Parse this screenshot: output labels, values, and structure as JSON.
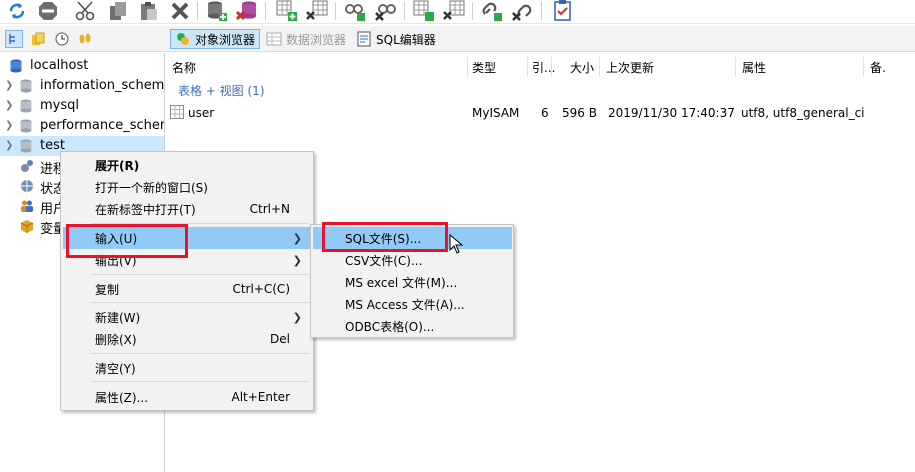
{
  "toolbar2": {
    "tabs": [
      {
        "label": "对象浏览器",
        "state": "active"
      },
      {
        "label": "数据浏览器",
        "state": "disabled"
      },
      {
        "label": "SQL编辑器",
        "state": "normal"
      }
    ]
  },
  "tree": {
    "items": [
      {
        "label": "localhost",
        "icon": "server-icon"
      },
      {
        "label": "information_schema",
        "icon": "database-icon"
      },
      {
        "label": "mysql",
        "icon": "database-icon"
      },
      {
        "label": "performance_schema",
        "icon": "database-icon"
      },
      {
        "label": "test",
        "icon": "database-icon",
        "selected": true
      },
      {
        "label": "进程",
        "icon": "process-icon"
      },
      {
        "label": "状态",
        "icon": "status-icon"
      },
      {
        "label": "用户",
        "icon": "users-icon"
      },
      {
        "label": "变量",
        "icon": "variables-icon"
      }
    ]
  },
  "table": {
    "columns": [
      "名称",
      "类型",
      "引...",
      "大小",
      "上次更新",
      "属性",
      "备."
    ],
    "group_label": "表格 + 视图 (1)",
    "rows": [
      {
        "name": "user",
        "type": "MyISAM",
        "rows": "6",
        "size": "596 B",
        "updated": "2019/11/30 17:40:37",
        "attrs": "utf8, utf8_general_ci"
      }
    ]
  },
  "context_menu": {
    "items": [
      {
        "label": "展开(R)",
        "bold": true
      },
      {
        "label": "打开一个新的窗口(S)"
      },
      {
        "label": "在新标签中打开(T)",
        "shortcut": "Ctrl+N"
      },
      {
        "label": "输入(U)",
        "submenu": true,
        "highlighted": true
      },
      {
        "label": "输出(V)",
        "submenu": true
      },
      {
        "label": "复制",
        "shortcut": "Ctrl+C(C)"
      },
      {
        "label": "新建(W)",
        "submenu": true
      },
      {
        "label": "删除(X)",
        "shortcut": "Del"
      },
      {
        "label": "清空(Y)"
      },
      {
        "label": "属性(Z)...",
        "shortcut": "Alt+Enter"
      }
    ]
  },
  "submenu": {
    "items": [
      {
        "label": "SQL文件(S)...",
        "highlighted": true
      },
      {
        "label": "CSV文件(C)..."
      },
      {
        "label": "MS excel 文件(M)..."
      },
      {
        "label": "MS Access 文件(A)..."
      },
      {
        "label": "ODBC表格(O)..."
      }
    ]
  },
  "colors": {
    "highlight_blue": "#91c9f7",
    "selected_tree": "#cce8ff",
    "annotation_red": "#e8132b",
    "group_text": "#3b6fb6"
  }
}
